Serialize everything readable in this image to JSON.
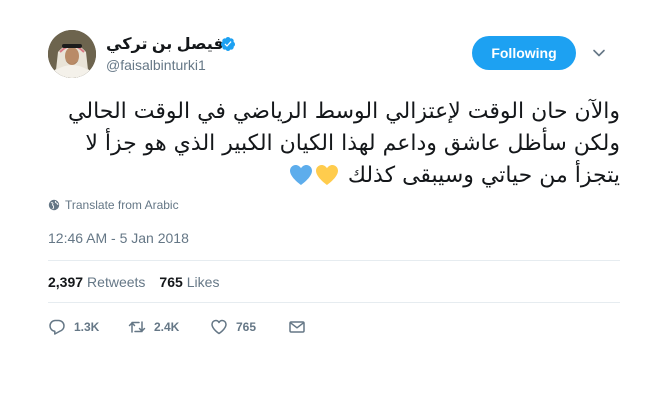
{
  "header": {
    "display_name": "فيصل بن تركي",
    "handle": "@faisalbinturki1",
    "follow_label": "Following"
  },
  "tweet": {
    "lines": [
      "والآن حان الوقت لإعتزالي الوسط الرياضي في الوقت الحالي",
      "ولكن سأظل عاشق وداعم لهذا الكيان الكبير الذي هو جزأ لا",
      "يتجزأ من حياتي وسيبقى كذلك"
    ],
    "emoji": [
      "yellow-heart",
      "blue-heart"
    ],
    "translate_label": "Translate from Arabic",
    "timestamp": "12:46 AM - 5 Jan 2018"
  },
  "stats": {
    "retweets_count": "2,397",
    "retweets_label": "Retweets",
    "likes_count": "765",
    "likes_label": "Likes"
  },
  "actions": {
    "reply_count": "1.3K",
    "retweet_count": "2.4K",
    "like_count": "765"
  },
  "colors": {
    "accent": "#1da1f2",
    "muted": "#657786",
    "text": "#14171a",
    "divider": "#e6ecf0",
    "yellow_heart": "#ffcc4d",
    "blue_heart": "#5dadec"
  }
}
